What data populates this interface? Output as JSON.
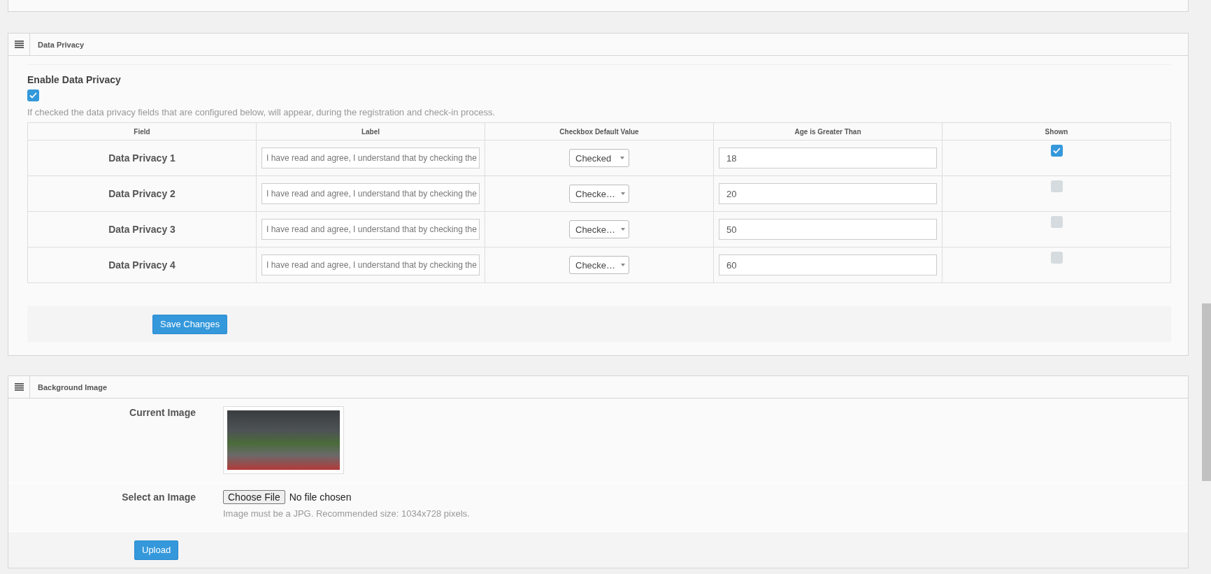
{
  "data_privacy": {
    "title": "Data Privacy",
    "enable_label": "Enable Data Privacy",
    "enable_checked": true,
    "help": "If checked the data privacy fields that are configured below, will appear, during the registration and check-in process.",
    "columns": [
      "Field",
      "Label",
      "Checkbox Default Value",
      "Age is Greater Than",
      "Shown"
    ],
    "rows": [
      {
        "field": "Data Privacy 1",
        "label": "I have read and agree, I understand that by checking the",
        "default_value": "Checked",
        "age": "18",
        "shown": true
      },
      {
        "field": "Data Privacy 2",
        "label": "I have read and agree, I understand that by checking the",
        "default_value": "Checke…",
        "age": "20",
        "shown": false
      },
      {
        "field": "Data Privacy 3",
        "label": "I have read and agree, I understand that by checking the",
        "default_value": "Checke…",
        "age": "50",
        "shown": false
      },
      {
        "field": "Data Privacy 4",
        "label": "I have read and agree, I understand that by checking the",
        "default_value": "Checke…",
        "age": "60",
        "shown": false
      }
    ],
    "save_button": "Save Changes"
  },
  "background_image": {
    "title": "Background Image",
    "current_label": "Current Image",
    "select_label": "Select an Image",
    "choose_button": "Choose File",
    "file_status": "No file chosen",
    "hint": "Image must be a JPG. Recommended size: 1034x728 pixels.",
    "upload_button": "Upload"
  }
}
